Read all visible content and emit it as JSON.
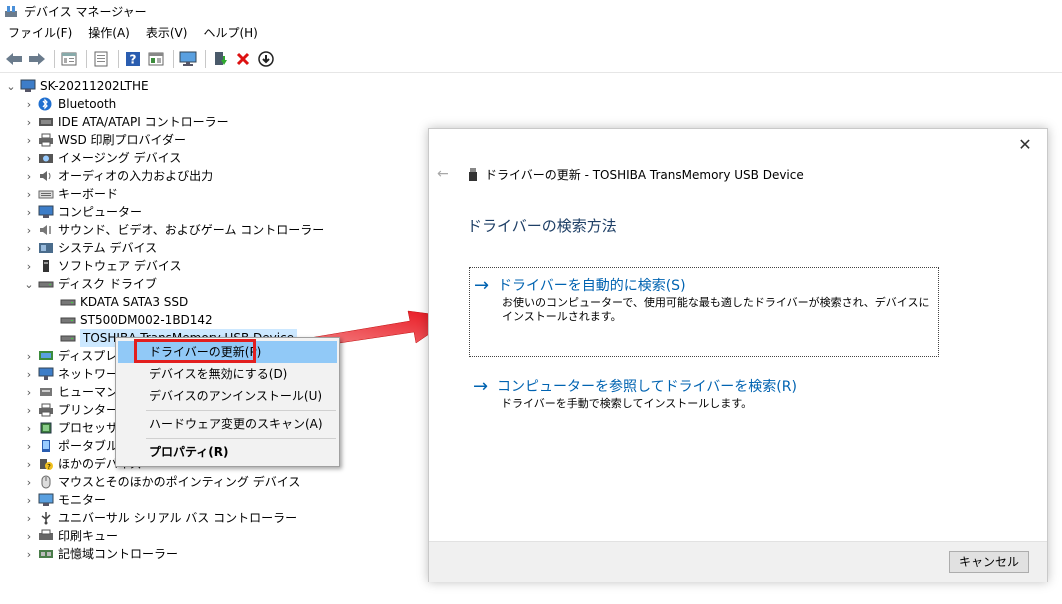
{
  "window": {
    "title": "デバイス マネージャー"
  },
  "menu": [
    "ファイル(F)",
    "操作(A)",
    "表示(V)",
    "ヘルプ(H)"
  ],
  "toolbar_icons": [
    "back-arrow-icon",
    "forward-arrow-icon",
    "properties-icon",
    "list-icon",
    "help-icon",
    "view-icon",
    "monitor-icon",
    "update-driver-icon",
    "uninstall-x-icon",
    "download-icon"
  ],
  "tree": {
    "root": "SK-20211202LTHE",
    "items": [
      {
        "label": "Bluetooth",
        "icon": "bluetooth-icon"
      },
      {
        "label": "IDE ATA/ATAPI コントローラー",
        "icon": "ide-controller-icon"
      },
      {
        "label": "WSD 印刷プロバイダー",
        "icon": "printer-icon"
      },
      {
        "label": "イメージング デバイス",
        "icon": "camera-icon"
      },
      {
        "label": "オーディオの入力および出力",
        "icon": "speaker-icon"
      },
      {
        "label": "キーボード",
        "icon": "keyboard-icon"
      },
      {
        "label": "コンピューター",
        "icon": "computer-icon"
      },
      {
        "label": "サウンド、ビデオ、およびゲーム コントローラー",
        "icon": "sound-icon"
      },
      {
        "label": "システム デバイス",
        "icon": "system-device-icon"
      },
      {
        "label": "ソフトウェア デバイス",
        "icon": "software-device-icon"
      },
      {
        "label": "ディスク ドライブ",
        "icon": "disk-drive-icon"
      }
    ],
    "disk_children": [
      "KDATA SATA3 SSD",
      "ST500DM002-1BD142",
      "TOSHIBA TransMemory USB Device"
    ],
    "items_after": [
      {
        "label": "ディスプレイ アダプター",
        "icon": "display-adapter-icon"
      },
      {
        "label": "ネットワーク アダプター",
        "icon": "network-icon"
      },
      {
        "label": "ヒューマン インターフェイス デバイス",
        "icon": "hid-icon"
      },
      {
        "label": "プリンター",
        "icon": "printer-icon"
      },
      {
        "label": "プロセッサ",
        "icon": "processor-icon"
      },
      {
        "label": "ポータブル デバイス",
        "icon": "portable-device-icon"
      },
      {
        "label": "ほかのデバイス",
        "icon": "other-device-icon"
      },
      {
        "label": "マウスとそのほかのポインティング デバイス",
        "icon": "mouse-icon"
      },
      {
        "label": "モニター",
        "icon": "monitor-icon"
      },
      {
        "label": "ユニバーサル シリアル バス コントローラー",
        "icon": "usb-controller-icon"
      },
      {
        "label": "印刷キュー",
        "icon": "print-queue-icon"
      },
      {
        "label": "記憶域コントローラー",
        "icon": "storage-controller-icon"
      }
    ]
  },
  "context_menu": {
    "items": [
      "ドライバーの更新(P)",
      "デバイスを無効にする(D)",
      "デバイスのアンインストール(U)",
      "ハードウェア変更のスキャン(A)",
      "プロパティ(R)"
    ]
  },
  "dialog": {
    "header": "ドライバーの更新 - TOSHIBA TransMemory USB Device",
    "title": "ドライバーの検索方法",
    "option1_title": "ドライバーを自動的に検索(S)",
    "option1_desc": "お使いのコンピューターで、使用可能な最も適したドライバーが検索され、デバイスにインストールされます。",
    "option2_title": "コンピューターを参照してドライバーを検索(R)",
    "option2_desc": "ドライバーを手動で検索してインストールします。",
    "cancel": "キャンセル",
    "close_glyph": "✕",
    "back_glyph": "←",
    "option_arrow": "→"
  },
  "colors": {
    "accent": "#0063b1",
    "highlight": "#91c9f7",
    "callout_red": "#e21f1f",
    "selection": "#cce8ff"
  }
}
